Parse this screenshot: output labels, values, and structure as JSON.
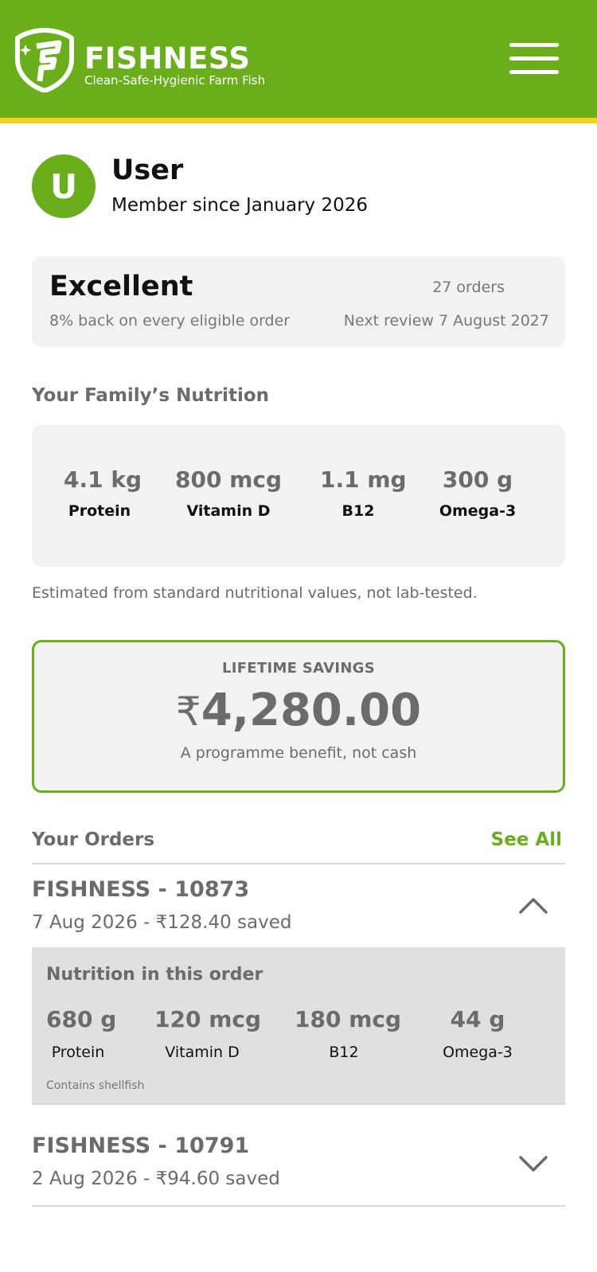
{
  "header": {
    "brand": "FISHNESS",
    "tagline": "Clean-Safe-Hygienic Farm Fish",
    "logo_icon": "fishness-shield-logo",
    "menu_icon": "hamburger-menu-icon",
    "colors": {
      "primary": "#6aaf1b",
      "stripe": "#f2d21a"
    }
  },
  "profile": {
    "avatar_initial": "U",
    "name": "User",
    "member_since": "Member since January 2026"
  },
  "tier": {
    "name": "Excellent",
    "description": "8% back on every eligible order",
    "orders": "27 orders",
    "next_review": "Next review 7 August 2027"
  },
  "nutrition": {
    "title": "Your Family’s Nutrition",
    "items": [
      {
        "value": "4.1 kg",
        "label": "Protein"
      },
      {
        "value": "800 mcg",
        "label": "Vitamin D"
      },
      {
        "value": "1.1 mg",
        "label": "B12"
      },
      {
        "value": "300 g",
        "label": "Omega-3"
      }
    ],
    "note": "Estimated from standard nutritional values, not lab-tested."
  },
  "savings": {
    "title": "LIFETIME SAVINGS",
    "currency": "₹",
    "amount": "4,280.00",
    "subtitle": "A programme benefit, not cash"
  },
  "orders": {
    "title": "Your Orders",
    "see_all": "See All",
    "list": [
      {
        "id": "FISHNESS - 10873",
        "meta": "7 Aug 2026 - ₹128.40 saved",
        "expanded": true,
        "detail": {
          "title": "Nutrition in this order",
          "items": [
            {
              "value": "680 g",
              "label": "Protein"
            },
            {
              "value": "120 mcg",
              "label": "Vitamin D"
            },
            {
              "value": "180 mcg",
              "label": "B12"
            },
            {
              "value": "44 g",
              "label": "Omega-3"
            }
          ],
          "note": "Contains shellfish"
        }
      },
      {
        "id": "FISHNESS - 10791",
        "meta": "2 Aug 2026 - ₹94.60 saved",
        "expanded": false
      }
    ]
  }
}
